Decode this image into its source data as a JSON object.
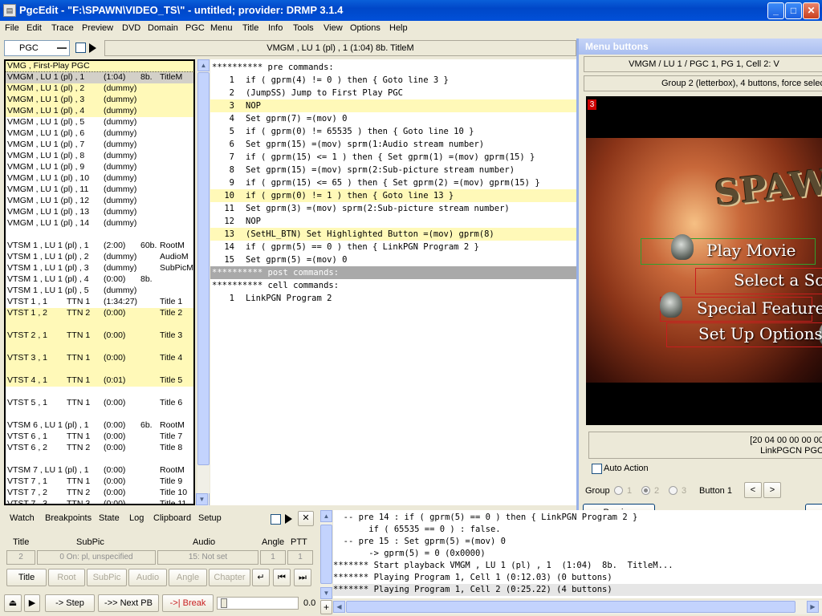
{
  "window": {
    "title": "PgcEdit - \"F:\\SPAWN\\VIDEO_TS\\\" - untitled; provider: DRMP 3.1.4",
    "minimize": "_",
    "maximize": "□",
    "close": "✕",
    "app_icon": "pgcedit-icon"
  },
  "menu": [
    "File",
    "Edit",
    "Trace",
    "Preview",
    "DVD",
    "Domain",
    "PGC",
    "Menu",
    "Title",
    "Info",
    "Tools",
    "View",
    "Options",
    "Help"
  ],
  "toolbar": {
    "pgc_combo": "PGC",
    "location": "VMGM , LU 1 (pl) , 1  (1:04)  8b.  TitleM"
  },
  "pgc_list": [
    {
      "c1": "VMG , First-Play PGC",
      "c2": "",
      "c3": "",
      "c4": "",
      "c5": "",
      "style": "hl"
    },
    {
      "c1": "VMGM , LU 1 (pl) , 1",
      "c2": "",
      "c3": "(1:04)",
      "c4": "8b.",
      "c5": "TitleM",
      "style": "sel"
    },
    {
      "c1": "VMGM , LU 1 (pl) , 2",
      "c2": "",
      "c3": "(dummy)",
      "c4": "",
      "c5": "",
      "style": "hl"
    },
    {
      "c1": "VMGM , LU 1 (pl) , 3",
      "c2": "",
      "c3": "(dummy)",
      "c4": "",
      "c5": "",
      "style": "hl"
    },
    {
      "c1": "VMGM , LU 1 (pl) , 4",
      "c2": "",
      "c3": "(dummy)",
      "c4": "",
      "c5": "",
      "style": "hl"
    },
    {
      "c1": "VMGM , LU 1 (pl) , 5",
      "c2": "",
      "c3": "(dummy)",
      "c4": "",
      "c5": "",
      "style": ""
    },
    {
      "c1": "VMGM , LU 1 (pl) , 6",
      "c2": "",
      "c3": "(dummy)",
      "c4": "",
      "c5": "",
      "style": ""
    },
    {
      "c1": "VMGM , LU 1 (pl) , 7",
      "c2": "",
      "c3": "(dummy)",
      "c4": "",
      "c5": "",
      "style": ""
    },
    {
      "c1": "VMGM , LU 1 (pl) , 8",
      "c2": "",
      "c3": "(dummy)",
      "c4": "",
      "c5": "",
      "style": ""
    },
    {
      "c1": "VMGM , LU 1 (pl) , 9",
      "c2": "",
      "c3": "(dummy)",
      "c4": "",
      "c5": "",
      "style": ""
    },
    {
      "c1": "VMGM , LU 1 (pl) , 10",
      "c2": "",
      "c3": "(dummy)",
      "c4": "",
      "c5": "",
      "style": ""
    },
    {
      "c1": "VMGM , LU 1 (pl) , 11",
      "c2": "",
      "c3": "(dummy)",
      "c4": "",
      "c5": "",
      "style": ""
    },
    {
      "c1": "VMGM , LU 1 (pl) , 12",
      "c2": "",
      "c3": "(dummy)",
      "c4": "",
      "c5": "",
      "style": ""
    },
    {
      "c1": "VMGM , LU 1 (pl) , 13",
      "c2": "",
      "c3": "(dummy)",
      "c4": "",
      "c5": "",
      "style": ""
    },
    {
      "c1": "VMGM , LU 1 (pl) , 14",
      "c2": "",
      "c3": "(dummy)",
      "c4": "",
      "c5": "",
      "style": ""
    },
    {
      "c1": "",
      "c2": "",
      "c3": "",
      "c4": "",
      "c5": "",
      "style": ""
    },
    {
      "c1": "VTSM 1 , LU 1 (pl) , 1",
      "c2": "",
      "c3": "(2:00)",
      "c4": "60b.",
      "c5": "RootM",
      "style": ""
    },
    {
      "c1": "VTSM 1 , LU 1 (pl) , 2",
      "c2": "",
      "c3": "(dummy)",
      "c4": "",
      "c5": "AudioM",
      "style": ""
    },
    {
      "c1": "VTSM 1 , LU 1 (pl) , 3",
      "c2": "",
      "c3": "(dummy)",
      "c4": "",
      "c5": "SubPicM",
      "style": ""
    },
    {
      "c1": "VTSM 1 , LU 1 (pl) , 4",
      "c2": "",
      "c3": "(0:00)",
      "c4": "8b.",
      "c5": "",
      "style": ""
    },
    {
      "c1": "VTSM 1 , LU 1 (pl) , 5",
      "c2": "",
      "c3": "(dummy)",
      "c4": "",
      "c5": "",
      "style": ""
    },
    {
      "c1": "VTST 1 , 1",
      "c2": "TTN 1",
      "c3": "(1:34:27)",
      "c4": "",
      "c5": "Title 1",
      "style": ""
    },
    {
      "c1": "VTST 1 , 2",
      "c2": "TTN 2",
      "c3": "(0:00)",
      "c4": "",
      "c5": "Title 2",
      "style": "hl"
    },
    {
      "c1": "",
      "c2": "",
      "c3": "",
      "c4": "",
      "c5": "",
      "style": "hl"
    },
    {
      "c1": "VTST 2 , 1",
      "c2": "TTN 1",
      "c3": "(0:00)",
      "c4": "",
      "c5": "Title 3",
      "style": "hl"
    },
    {
      "c1": "",
      "c2": "",
      "c3": "",
      "c4": "",
      "c5": "",
      "style": "hl"
    },
    {
      "c1": "VTST 3 , 1",
      "c2": "TTN 1",
      "c3": "(0:00)",
      "c4": "",
      "c5": "Title 4",
      "style": "hl"
    },
    {
      "c1": "",
      "c2": "",
      "c3": "",
      "c4": "",
      "c5": "",
      "style": "hl"
    },
    {
      "c1": "VTST 4 , 1",
      "c2": "TTN 1",
      "c3": "(0:01)",
      "c4": "",
      "c5": "Title 5",
      "style": "hl"
    },
    {
      "c1": "",
      "c2": "",
      "c3": "",
      "c4": "",
      "c5": "",
      "style": ""
    },
    {
      "c1": "VTST 5 , 1",
      "c2": "TTN 1",
      "c3": "(0:00)",
      "c4": "",
      "c5": "Title 6",
      "style": ""
    },
    {
      "c1": "",
      "c2": "",
      "c3": "",
      "c4": "",
      "c5": "",
      "style": ""
    },
    {
      "c1": "VTSM 6 , LU 1 (pl) , 1",
      "c2": "",
      "c3": "(0:00)",
      "c4": "6b.",
      "c5": "RootM",
      "style": ""
    },
    {
      "c1": "VTST 6 , 1",
      "c2": "TTN 1",
      "c3": "(0:00)",
      "c4": "",
      "c5": "Title 7",
      "style": ""
    },
    {
      "c1": "VTST 6 , 2",
      "c2": "TTN 2",
      "c3": "(0:00)",
      "c4": "",
      "c5": "Title 8",
      "style": ""
    },
    {
      "c1": "",
      "c2": "",
      "c3": "",
      "c4": "",
      "c5": "",
      "style": ""
    },
    {
      "c1": "VTSM 7 , LU 1 (pl) , 1",
      "c2": "",
      "c3": "(0:00)",
      "c4": "",
      "c5": "RootM",
      "style": ""
    },
    {
      "c1": "VTST 7 , 1",
      "c2": "TTN 1",
      "c3": "(0:00)",
      "c4": "",
      "c5": "Title 9",
      "style": ""
    },
    {
      "c1": "VTST 7 , 2",
      "c2": "TTN 2",
      "c3": "(0:00)",
      "c4": "",
      "c5": "Title 10",
      "style": ""
    },
    {
      "c1": "VTST 7 , 3",
      "c2": "TTN 3",
      "c3": "(0:00)",
      "c4": "",
      "c5": "Title 11",
      "style": ""
    }
  ],
  "commands": [
    {
      "type": "hdr",
      "text": "********** pre commands:"
    },
    {
      "type": "cmd",
      "num": "1",
      "text": "if ( gprm(4) != 0 ) then { Goto line 3 }"
    },
    {
      "type": "cmd",
      "num": "2",
      "text": "(JumpSS) Jump to First Play PGC"
    },
    {
      "type": "cmd",
      "num": "3",
      "text": "NOP",
      "hl": true
    },
    {
      "type": "cmd",
      "num": "4",
      "text": "Set gprm(7) =(mov) 0"
    },
    {
      "type": "cmd",
      "num": "5",
      "text": "if ( gprm(0) != 65535 ) then { Goto line 10 }"
    },
    {
      "type": "cmd",
      "num": "6",
      "text": "Set gprm(15) =(mov) sprm(1:Audio stream number)"
    },
    {
      "type": "cmd",
      "num": "7",
      "text": "if ( gprm(15) <= 1 ) then { Set gprm(1) =(mov) gprm(15) }"
    },
    {
      "type": "cmd",
      "num": "8",
      "text": "Set gprm(15) =(mov) sprm(2:Sub-picture stream number)"
    },
    {
      "type": "cmd",
      "num": "9",
      "text": "if ( gprm(15) <= 65 ) then { Set gprm(2) =(mov) gprm(15) }"
    },
    {
      "type": "cmd",
      "num": "10",
      "text": "if ( gprm(0) != 1 ) then { Goto line 13 }",
      "hl": true
    },
    {
      "type": "cmd",
      "num": "11",
      "text": "Set gprm(3) =(mov) sprm(2:Sub-picture stream number)"
    },
    {
      "type": "cmd",
      "num": "12",
      "text": "NOP"
    },
    {
      "type": "cmd",
      "num": "13",
      "text": "(SetHL_BTN) Set Highlighted Button =(mov) gprm(8)",
      "hl": true
    },
    {
      "type": "cmd",
      "num": "14",
      "text": "if ( gprm(5) == 0 ) then { LinkPGN Program 2 }"
    },
    {
      "type": "cmd",
      "num": "15",
      "text": "Set gprm(5) =(mov) 0"
    },
    {
      "type": "sep",
      "text": "********** post commands:"
    },
    {
      "type": "hdr",
      "text": "********** cell commands:"
    },
    {
      "type": "cmd",
      "num": "1",
      "text": "LinkPGN Program 2"
    }
  ],
  "menu_buttons": {
    "title": "Menu buttons",
    "location": "VMGM / LU 1 / PGC 1, PG 1, Cell 2: V",
    "group_info": "Group 2 (letterbox), 4 buttons, force select",
    "button_number": "3",
    "logo": "SPAWN",
    "items": [
      "Play Movie",
      "Select a Scene",
      "Special Features",
      "Set Up Options"
    ],
    "hex": "[20 04 00 00 00 00",
    "command": "LinkPGCN PGC",
    "auto_action": "Auto Action",
    "group_label": "Group",
    "groups": [
      "1",
      "2",
      "3"
    ],
    "button_label": "Button 1",
    "prev": "<",
    "next": ">",
    "preview_btn": "Preview",
    "colors": {
      "green_box": "#2fa02f",
      "red_box": "#c81e1e"
    }
  },
  "bottom_tabs": [
    "Watch",
    "Breakpoints",
    "State",
    "Log",
    "Clipboard",
    "Setup"
  ],
  "state": {
    "headers": {
      "title": "Title",
      "subpic": "SubPic",
      "audio": "Audio",
      "angle": "Angle",
      "ptt": "PTT"
    },
    "values": {
      "title": "2",
      "subpic": "0 On: pl, unspecified",
      "audio": "15: Not set",
      "angle": "1",
      "ptt": "1"
    },
    "buttons": [
      "Title",
      "Root",
      "SubPic",
      "Audio",
      "Angle",
      "Chapter"
    ],
    "step": "-> Step",
    "next_pb": "->> Next PB",
    "break": "->| Break",
    "speed": "0.0"
  },
  "log": [
    "  -- pre 14 : if ( gprm(5) == 0 ) then { LinkPGN Program 2 }",
    "       if ( 65535 == 0 ) : false.",
    "  -- pre 15 : Set gprm(5) =(mov) 0",
    "       -> gprm(5) = 0 (0x0000)",
    "******* Start playback VMGM , LU 1 (pl) , 1  (1:04)  8b.  TitleM...",
    "******* Playing Program 1, Cell 1 (0:12.03) (0 buttons)",
    "******* Playing Program 1, Cell 2 (0:25.22) (4 buttons)"
  ]
}
